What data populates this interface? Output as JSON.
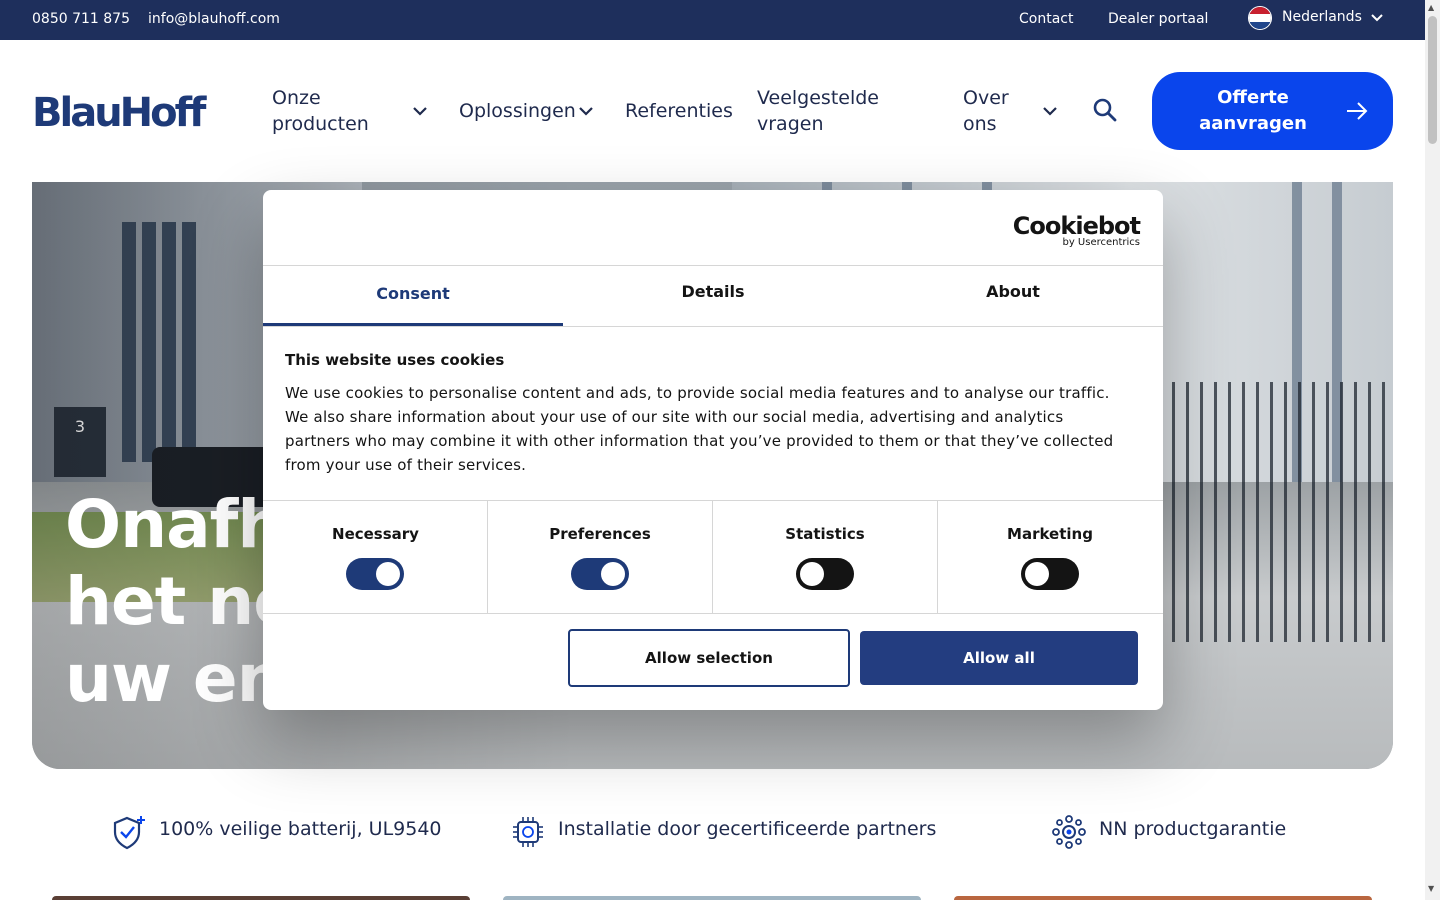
{
  "topbar": {
    "phone": "0850 711 875",
    "email": "info@blauhoff.com",
    "contact": "Contact",
    "dealer": "Dealer portaal",
    "language": "Nederlands",
    "language_flag_icon": "netherlands-flag-icon",
    "background": "#1e2f5c"
  },
  "header": {
    "logo": "BlauHoff",
    "nav": {
      "products_line1": "Onze",
      "products_line2": "producten",
      "solutions": "Oplossingen",
      "references": "Referenties",
      "faq_line1": "Veelgestelde",
      "faq_line2": "vragen",
      "about_line1": "Over",
      "about_line2": "ons"
    },
    "search_icon": "search-icon",
    "cta_line1": "Offerte",
    "cta_line2": "aanvragen",
    "cta_color": "#0a45ec"
  },
  "hero": {
    "sign_number": "3",
    "heading_line1": "Onafh",
    "heading_line2": "het ne",
    "heading_line3": "uw en"
  },
  "features": [
    {
      "icon": "shield-plus-icon",
      "label": "100% veilige batterij, UL9540"
    },
    {
      "icon": "chip-icon",
      "label": "Installatie door gecertificeerde partners"
    },
    {
      "icon": "gear-network-icon",
      "label": "NN productgarantie"
    }
  ],
  "cookie_dialog": {
    "brand": "Cookiebot",
    "brand_sub": "by Usercentrics",
    "tabs": [
      "Consent",
      "Details",
      "About"
    ],
    "active_tab": "Consent",
    "title": "This website uses cookies",
    "body": "We use cookies to personalise content and ads, to provide social media features and to analyse our traffic. We also share information about your use of our site with our social media, advertising and analytics partners who may combine it with other information that you’ve provided to them or that they’ve collected from your use of their services.",
    "toggles": [
      {
        "label": "Necessary",
        "on": true
      },
      {
        "label": "Preferences",
        "on": true
      },
      {
        "label": "Statistics",
        "on": false
      },
      {
        "label": "Marketing",
        "on": false
      }
    ],
    "allow_selection": "Allow selection",
    "allow_all": "Allow all",
    "accent": "#1e3a78"
  }
}
